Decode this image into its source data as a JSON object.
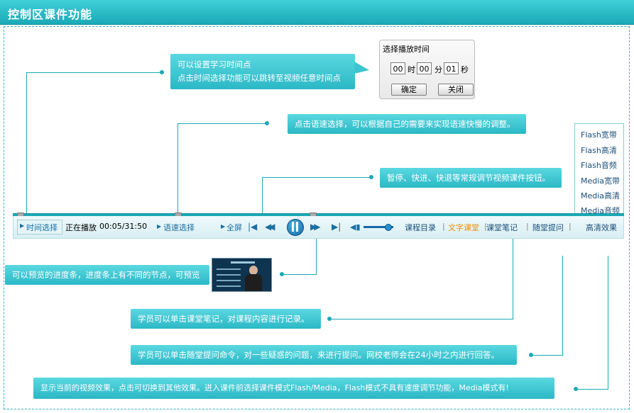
{
  "header": {
    "title": "控制区课件功能"
  },
  "callouts": {
    "time_line1": "可以设置学习时间点",
    "time_line2": "点击时间选择功能可以跳转至视频任意时间点",
    "speed": "点击语速选择，可以根据自己的需要来实现语速快慢的调整。",
    "playback": "暂停、快进、快退等常规调节视频课件按钮。",
    "preview": "可以预览的进度条，进度条上有不同的节点，可预览",
    "notes": "学员可以单击课堂笔记，对课程内容进行记录。",
    "question": "学员可以单击随堂提问命令，对一些疑惑的问题，来进行提问。网校老师会在24小时之内进行回答。",
    "quality": "显示当前的视频效果，点击可切换到其他效果。进入课件前选择课件模式Flash/Media，Flash模式不具有速度调节功能，Media模式有!"
  },
  "dialog": {
    "title": "选择播放时间",
    "hour": "00",
    "hour_unit": "时",
    "minute": "00",
    "minute_unit": "分",
    "second": "01",
    "second_unit": "秒",
    "ok": "确定",
    "close": "关闭"
  },
  "quality_menu": [
    "Flash宽带",
    "Flash高清",
    "Flash音频",
    "Media宽带",
    "Media高清",
    "Media音频"
  ],
  "player": {
    "time_select": "时间选择",
    "now_playing": "正在播放",
    "time": "00:05/31:50",
    "speed_select": "语速选择",
    "fullscreen": "全屏",
    "catalog": "课程目录",
    "text_class": "文字课堂",
    "notes": "课堂笔记",
    "question": "随堂提问",
    "quality": "高清效果",
    "progress": 0.49,
    "volume": 0.8
  },
  "colors": {
    "teal": "#1aa9b6",
    "highlight": "#f08c00",
    "link": "#1a6fa3"
  }
}
